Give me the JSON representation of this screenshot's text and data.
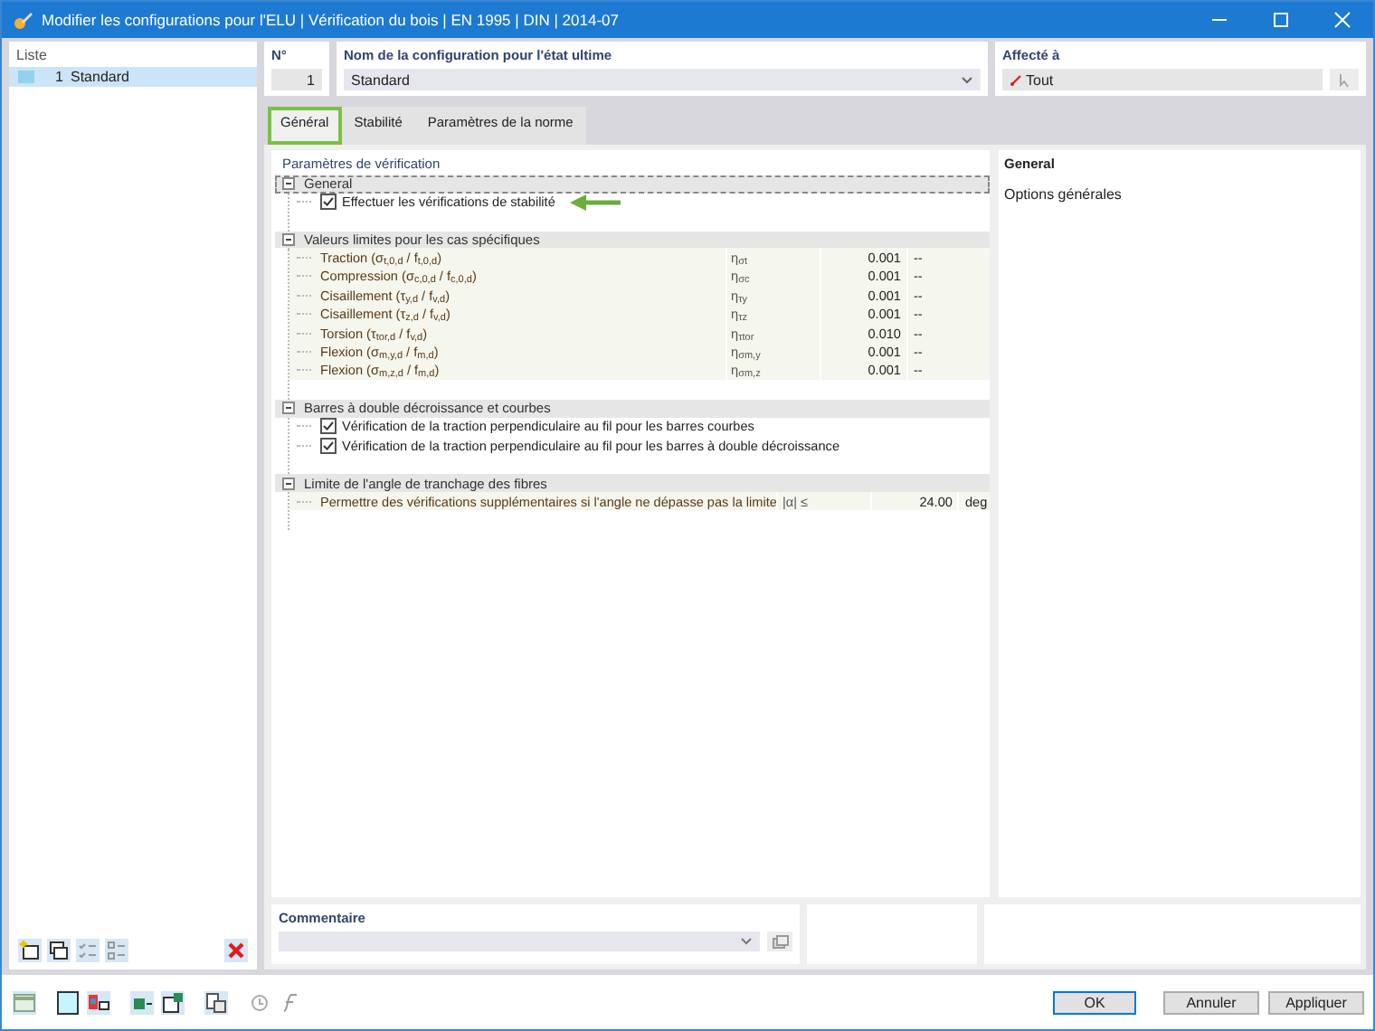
{
  "window": {
    "title": "Modifier les configurations pour l'ELU | Vérification du bois | EN 1995 | DIN | 2014-07"
  },
  "list": {
    "title": "Liste",
    "items": [
      {
        "number": "1",
        "name": "Standard",
        "color": "#8fd3f0",
        "selected": true
      }
    ]
  },
  "number_field": {
    "label": "N°",
    "value": "1"
  },
  "name_field": {
    "label": "Nom de la configuration pour l'état ultime",
    "value": "Standard"
  },
  "assigned_field": {
    "label": "Affecté à",
    "value": "Tout"
  },
  "tabs": [
    {
      "label": "Général",
      "selected": true,
      "highlighted": true
    },
    {
      "label": "Stabilité",
      "selected": false,
      "highlighted": false
    },
    {
      "label": "Paramètres de la norme",
      "selected": false,
      "highlighted": false
    }
  ],
  "parameters": {
    "title": "Paramètres de vérification",
    "groups": [
      {
        "title": "General",
        "expanded": true,
        "focused": true,
        "rows": [
          {
            "kind": "check",
            "label": "Effectuer les vérifications de stabilité",
            "checked": true,
            "arrow": true
          }
        ]
      },
      {
        "title": "Valeurs limites pour les cas spécifiques",
        "expanded": true,
        "focused": false,
        "rows": [
          {
            "kind": "value",
            "label": "Traction (σ$_{t,0,d}$ / f$_{t,0,d}$)",
            "symbol": "η$_{σt}$",
            "value": "0.001",
            "unit": "--"
          },
          {
            "kind": "value",
            "label": "Compression (σ$_{c,0,d}$ / f$_{c,0,d}$)",
            "symbol": "η$_{σc}$",
            "value": "0.001",
            "unit": "--"
          },
          {
            "kind": "value",
            "label": "Cisaillement (τ$_{y,d}$ / f$_{v,d}$)",
            "symbol": "η$_{τy}$",
            "value": "0.001",
            "unit": "--"
          },
          {
            "kind": "value",
            "label": "Cisaillement (τ$_{z,d}$ / f$_{v,d}$)",
            "symbol": "η$_{τz}$",
            "value": "0.001",
            "unit": "--"
          },
          {
            "kind": "value",
            "label": "Torsion (τ$_{tor,d}$ / f$_{v,d}$)",
            "symbol": "η$_{τtor}$",
            "value": "0.010",
            "unit": "--"
          },
          {
            "kind": "value",
            "label": "Flexion (σ$_{m,y,d}$ / f$_{m,d}$)",
            "symbol": "η$_{σm,y}$",
            "value": "0.001",
            "unit": "--"
          },
          {
            "kind": "value",
            "label": "Flexion (σ$_{m,z,d}$ / f$_{m,d}$)",
            "symbol": "η$_{σm,z}$",
            "value": "0.001",
            "unit": "--"
          }
        ]
      },
      {
        "title": "Barres à double décroissance et courbes",
        "expanded": true,
        "focused": false,
        "rows": [
          {
            "kind": "check",
            "label": "Vérification de la traction perpendiculaire au fil pour les barres courbes",
            "checked": true,
            "arrow": false
          },
          {
            "kind": "check",
            "label": "Vérification de la traction perpendiculaire au fil pour les barres à double décroissance",
            "checked": true,
            "arrow": false
          }
        ]
      },
      {
        "title": "Limite de l'angle de tranchage des fibres",
        "expanded": true,
        "focused": false,
        "rows": [
          {
            "kind": "value",
            "label": "Permettre des vérifications supplémentaires si l'angle ne dépasse pas la limite",
            "symbol": "|α| ≤",
            "value": "24.00",
            "unit": "deg"
          }
        ]
      }
    ]
  },
  "info": {
    "title": "General",
    "text": "Options générales"
  },
  "comment": {
    "label": "Commentaire"
  },
  "buttons": [
    {
      "label": "OK",
      "default": true
    },
    {
      "label": "Annuler",
      "default": false
    },
    {
      "label": "Appliquer",
      "default": false
    }
  ]
}
